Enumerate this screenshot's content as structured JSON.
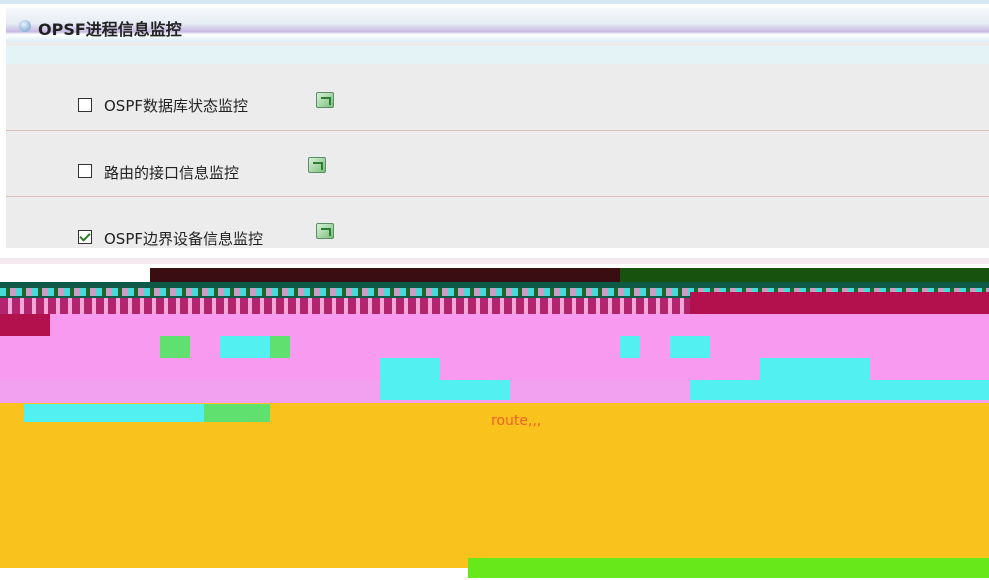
{
  "panel": {
    "title": "OPSF进程信息监控",
    "items": [
      {
        "label": "OSPF数据库状态监控",
        "checked": false,
        "action_icon": "refresh-go-icon"
      },
      {
        "label": "路由的接口信息监控",
        "checked": false,
        "action_icon": "refresh-go-icon"
      },
      {
        "label": "OSPF边界设备信息监控",
        "checked": true,
        "action_icon": "refresh-go-icon"
      }
    ]
  },
  "glitch_text": "route,,,"
}
